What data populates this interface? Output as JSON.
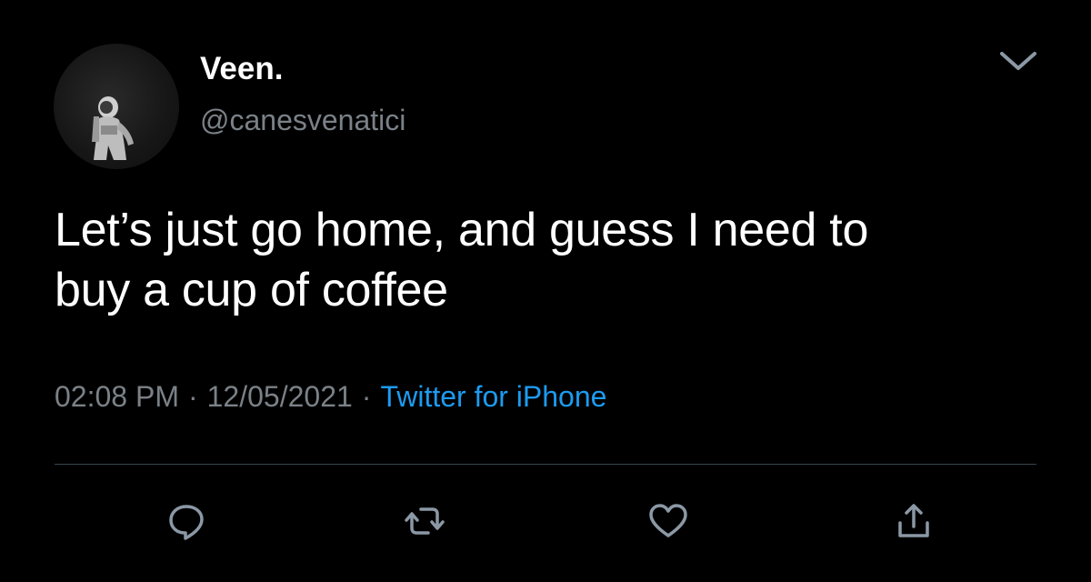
{
  "user": {
    "display_name": "Veen.",
    "handle": "@canesvenatici",
    "avatar_icon": "astronaut-avatar"
  },
  "tweet": {
    "text_lines": [
      "Let’s just go home, and guess I need to",
      "buy a cup of coffee"
    ],
    "time": "02:08 PM",
    "date": "12/05/2021",
    "separator": "·",
    "source": "Twitter for iPhone"
  },
  "actions": [
    {
      "name": "reply",
      "icon": "speech-bubble-icon"
    },
    {
      "name": "retweet",
      "icon": "retweet-icon"
    },
    {
      "name": "like",
      "icon": "heart-icon"
    },
    {
      "name": "share",
      "icon": "share-icon"
    }
  ],
  "colors": {
    "background": "#000000",
    "text_primary": "#ffffff",
    "text_secondary": "#7a8187",
    "link": "#1d9bf0",
    "icon": "#8b98a5",
    "divider": "#38444d"
  }
}
